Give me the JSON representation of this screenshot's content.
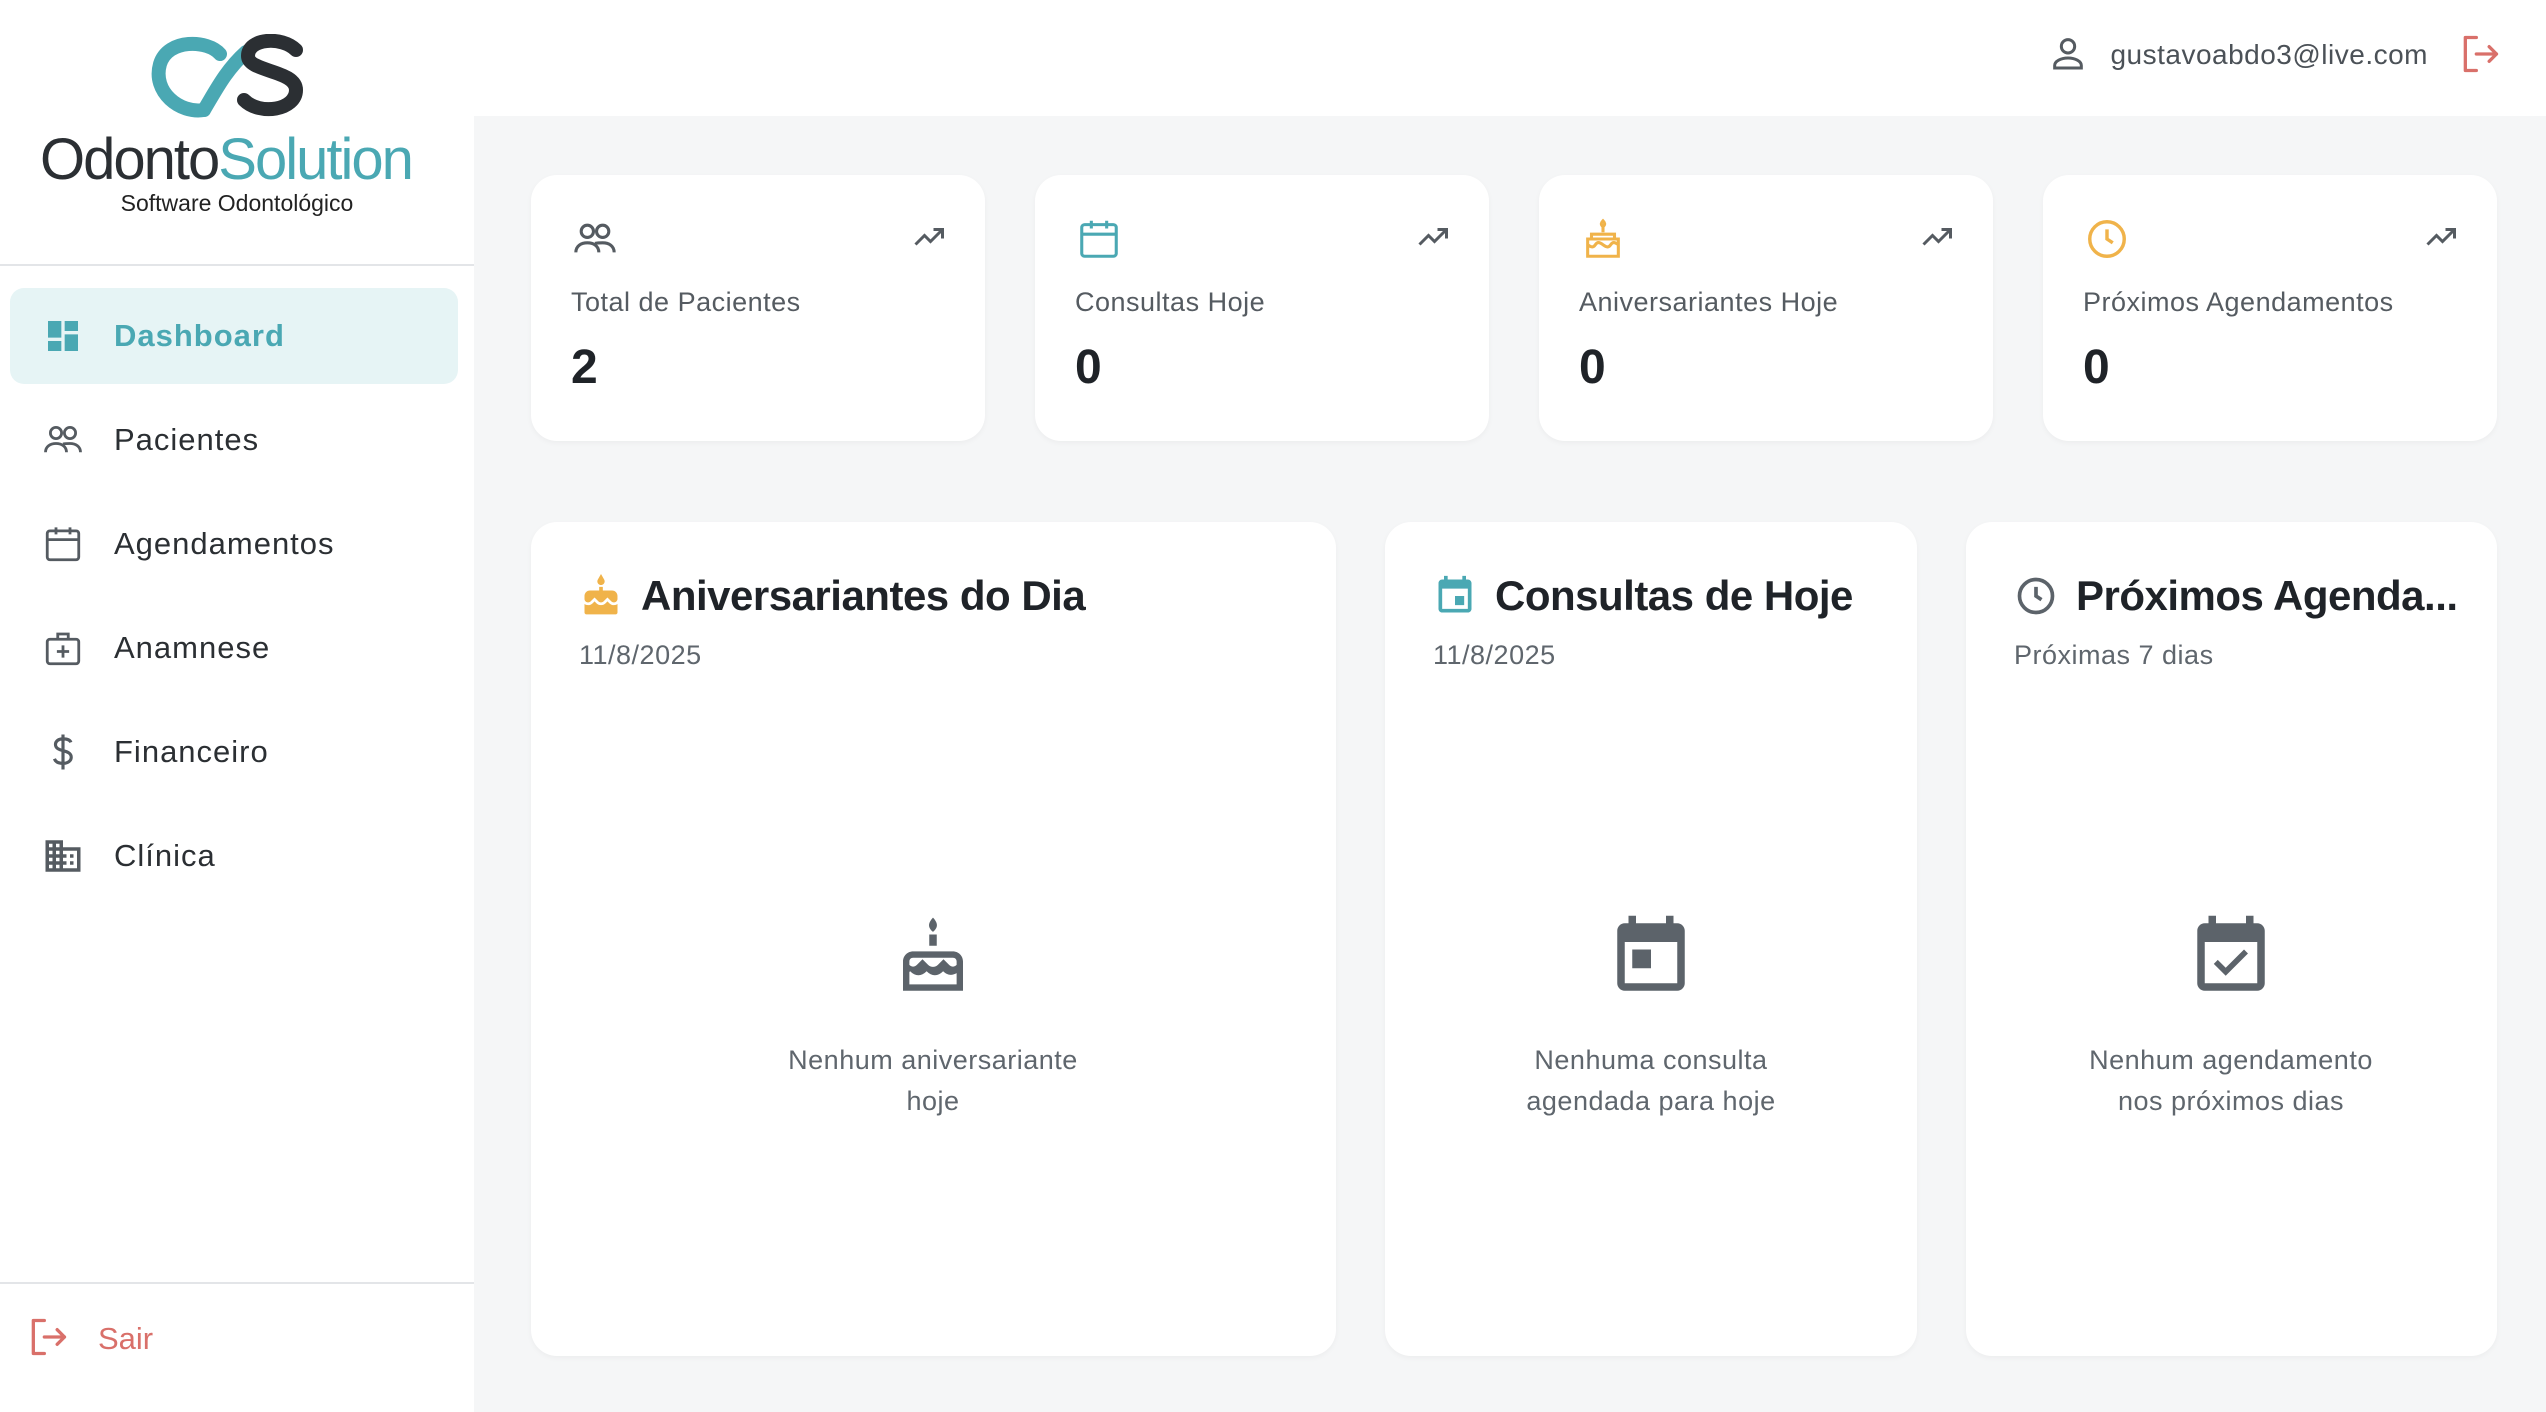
{
  "brand": {
    "logo_odonto": "Odonto",
    "logo_solution": "Solution",
    "tagline": "Software Odontológico",
    "accent": "#4aa8b3",
    "danger": "#d9706a",
    "orange": "#f0b34a"
  },
  "sidebar": {
    "items": [
      {
        "label": "Dashboard",
        "icon": "dashboard-icon",
        "active": true
      },
      {
        "label": "Pacientes",
        "icon": "people-icon"
      },
      {
        "label": "Agendamentos",
        "icon": "calendar-icon"
      },
      {
        "label": "Anamnese",
        "icon": "medical-bag-icon"
      },
      {
        "label": "Financeiro",
        "icon": "dollar-icon"
      },
      {
        "label": "Clínica",
        "icon": "building-icon"
      }
    ],
    "logout_label": "Sair"
  },
  "header": {
    "user_email": "gustavoabdo3@live.com"
  },
  "stats": [
    {
      "label": "Total de Pacientes",
      "value": "2",
      "icon": "people-icon"
    },
    {
      "label": "Consultas Hoje",
      "value": "0",
      "icon": "calendar-icon"
    },
    {
      "label": "Aniversariantes Hoje",
      "value": "0",
      "icon": "cake-icon"
    },
    {
      "label": "Próximos Agendamentos",
      "value": "0",
      "icon": "clock-icon"
    }
  ],
  "panels": [
    {
      "title": "Aniversariantes do Dia",
      "subtitle": "11/8/2025",
      "empty_line1": "Nenhum aniversariante",
      "empty_line2": "hoje"
    },
    {
      "title": "Consultas de Hoje",
      "subtitle": "11/8/2025",
      "empty_line1": "Nenhuma consulta",
      "empty_line2": "agendada para hoje"
    },
    {
      "title": "Próximos Agenda...",
      "subtitle": "Próximas 7 dias",
      "empty_line1": "Nenhum agendamento",
      "empty_line2": "nos próximos dias"
    }
  ]
}
